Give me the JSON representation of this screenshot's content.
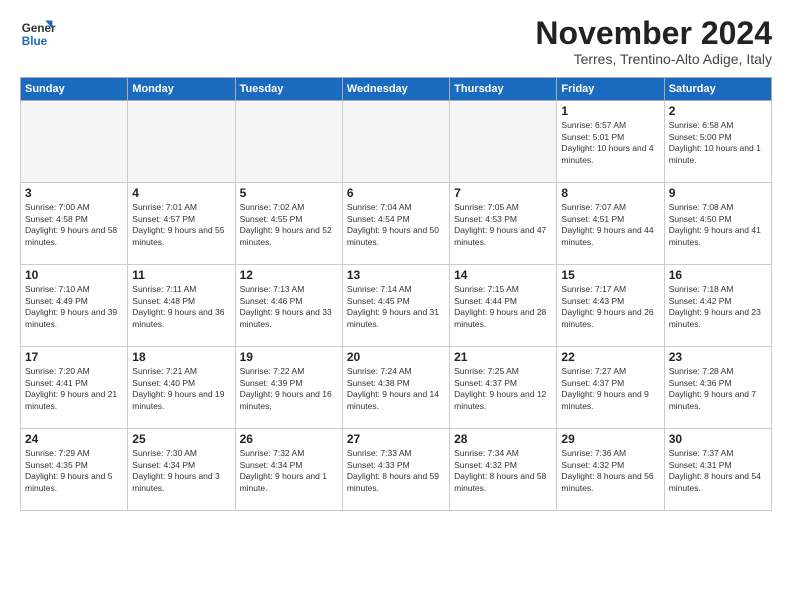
{
  "header": {
    "logo_line1": "General",
    "logo_line2": "Blue",
    "month": "November 2024",
    "location": "Terres, Trentino-Alto Adige, Italy"
  },
  "weekdays": [
    "Sunday",
    "Monday",
    "Tuesday",
    "Wednesday",
    "Thursday",
    "Friday",
    "Saturday"
  ],
  "weeks": [
    [
      {
        "day": "",
        "empty": true
      },
      {
        "day": "",
        "empty": true
      },
      {
        "day": "",
        "empty": true
      },
      {
        "day": "",
        "empty": true
      },
      {
        "day": "",
        "empty": true
      },
      {
        "day": "1",
        "sunrise": "6:57 AM",
        "sunset": "5:01 PM",
        "daylight": "10 hours and 4 minutes."
      },
      {
        "day": "2",
        "sunrise": "6:58 AM",
        "sunset": "5:00 PM",
        "daylight": "10 hours and 1 minute."
      }
    ],
    [
      {
        "day": "3",
        "sunrise": "7:00 AM",
        "sunset": "4:58 PM",
        "daylight": "9 hours and 58 minutes."
      },
      {
        "day": "4",
        "sunrise": "7:01 AM",
        "sunset": "4:57 PM",
        "daylight": "9 hours and 55 minutes."
      },
      {
        "day": "5",
        "sunrise": "7:02 AM",
        "sunset": "4:55 PM",
        "daylight": "9 hours and 52 minutes."
      },
      {
        "day": "6",
        "sunrise": "7:04 AM",
        "sunset": "4:54 PM",
        "daylight": "9 hours and 50 minutes."
      },
      {
        "day": "7",
        "sunrise": "7:05 AM",
        "sunset": "4:53 PM",
        "daylight": "9 hours and 47 minutes."
      },
      {
        "day": "8",
        "sunrise": "7:07 AM",
        "sunset": "4:51 PM",
        "daylight": "9 hours and 44 minutes."
      },
      {
        "day": "9",
        "sunrise": "7:08 AM",
        "sunset": "4:50 PM",
        "daylight": "9 hours and 41 minutes."
      }
    ],
    [
      {
        "day": "10",
        "sunrise": "7:10 AM",
        "sunset": "4:49 PM",
        "daylight": "9 hours and 39 minutes."
      },
      {
        "day": "11",
        "sunrise": "7:11 AM",
        "sunset": "4:48 PM",
        "daylight": "9 hours and 36 minutes."
      },
      {
        "day": "12",
        "sunrise": "7:13 AM",
        "sunset": "4:46 PM",
        "daylight": "9 hours and 33 minutes."
      },
      {
        "day": "13",
        "sunrise": "7:14 AM",
        "sunset": "4:45 PM",
        "daylight": "9 hours and 31 minutes."
      },
      {
        "day": "14",
        "sunrise": "7:15 AM",
        "sunset": "4:44 PM",
        "daylight": "9 hours and 28 minutes."
      },
      {
        "day": "15",
        "sunrise": "7:17 AM",
        "sunset": "4:43 PM",
        "daylight": "9 hours and 26 minutes."
      },
      {
        "day": "16",
        "sunrise": "7:18 AM",
        "sunset": "4:42 PM",
        "daylight": "9 hours and 23 minutes."
      }
    ],
    [
      {
        "day": "17",
        "sunrise": "7:20 AM",
        "sunset": "4:41 PM",
        "daylight": "9 hours and 21 minutes."
      },
      {
        "day": "18",
        "sunrise": "7:21 AM",
        "sunset": "4:40 PM",
        "daylight": "9 hours and 19 minutes."
      },
      {
        "day": "19",
        "sunrise": "7:22 AM",
        "sunset": "4:39 PM",
        "daylight": "9 hours and 16 minutes."
      },
      {
        "day": "20",
        "sunrise": "7:24 AM",
        "sunset": "4:38 PM",
        "daylight": "9 hours and 14 minutes."
      },
      {
        "day": "21",
        "sunrise": "7:25 AM",
        "sunset": "4:37 PM",
        "daylight": "9 hours and 12 minutes."
      },
      {
        "day": "22",
        "sunrise": "7:27 AM",
        "sunset": "4:37 PM",
        "daylight": "9 hours and 9 minutes."
      },
      {
        "day": "23",
        "sunrise": "7:28 AM",
        "sunset": "4:36 PM",
        "daylight": "9 hours and 7 minutes."
      }
    ],
    [
      {
        "day": "24",
        "sunrise": "7:29 AM",
        "sunset": "4:35 PM",
        "daylight": "9 hours and 5 minutes."
      },
      {
        "day": "25",
        "sunrise": "7:30 AM",
        "sunset": "4:34 PM",
        "daylight": "9 hours and 3 minutes."
      },
      {
        "day": "26",
        "sunrise": "7:32 AM",
        "sunset": "4:34 PM",
        "daylight": "9 hours and 1 minute."
      },
      {
        "day": "27",
        "sunrise": "7:33 AM",
        "sunset": "4:33 PM",
        "daylight": "8 hours and 59 minutes."
      },
      {
        "day": "28",
        "sunrise": "7:34 AM",
        "sunset": "4:32 PM",
        "daylight": "8 hours and 58 minutes."
      },
      {
        "day": "29",
        "sunrise": "7:36 AM",
        "sunset": "4:32 PM",
        "daylight": "8 hours and 56 minutes."
      },
      {
        "day": "30",
        "sunrise": "7:37 AM",
        "sunset": "4:31 PM",
        "daylight": "8 hours and 54 minutes."
      }
    ]
  ]
}
